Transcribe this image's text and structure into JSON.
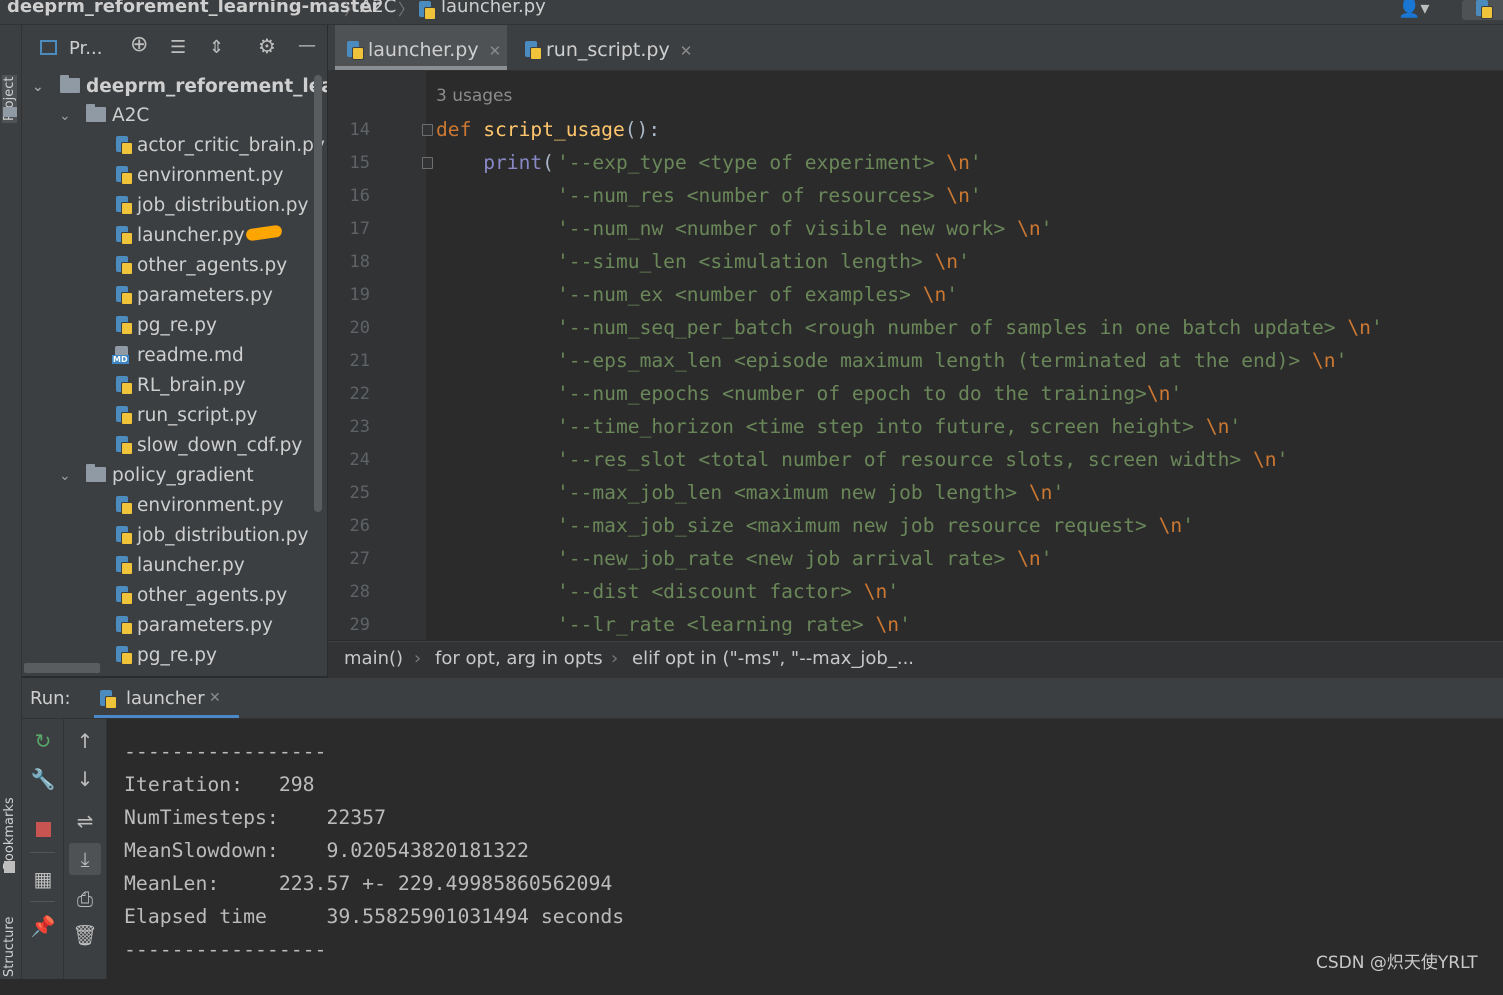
{
  "navbar": {
    "project": "deeprm_reforement_learning-master",
    "folder": "A2C",
    "file": "launcher.py"
  },
  "left_stripe": {
    "project_tab": "Project",
    "bookmarks_tab": "Bookmarks",
    "structure_tab": "Structure"
  },
  "project_panel": {
    "title": "Pr...",
    "root": "deeprm_reforement_learni",
    "folders": [
      {
        "name": "A2C",
        "files": [
          "actor_critic_brain.py",
          "environment.py",
          "job_distribution.py",
          "launcher.py",
          "other_agents.py",
          "parameters.py",
          "pg_re.py",
          "readme.md",
          "RL_brain.py",
          "run_script.py",
          "slow_down_cdf.py"
        ]
      },
      {
        "name": "policy_gradient",
        "files": [
          "environment.py",
          "job_distribution.py",
          "launcher.py",
          "other_agents.py",
          "parameters.py",
          "pg_re.py"
        ]
      }
    ]
  },
  "editor_tabs": [
    "launcher.py",
    "run_script.py"
  ],
  "editor": {
    "usages": "3 usages",
    "line_numbers": [
      "14",
      "15",
      "16",
      "17",
      "18",
      "19",
      "20",
      "21",
      "22",
      "23",
      "24",
      "25",
      "26",
      "27",
      "28",
      "29"
    ],
    "def_keyword": "def",
    "func_name": "script_usage",
    "def_tail": "():",
    "print_fn": "print",
    "print_paren": "(",
    "strings": [
      {
        "text": "'--exp_type <type of experiment> ",
        "esc": "\\n",
        "end": "'"
      },
      {
        "text": "'--num_res <number of resources> ",
        "esc": "\\n",
        "end": "'"
      },
      {
        "text": "'--num_nw <number of visible new work> ",
        "esc": "\\n",
        "end": "'"
      },
      {
        "text": "'--simu_len <simulation length> ",
        "esc": "\\n",
        "end": "'"
      },
      {
        "text": "'--num_ex <number of examples> ",
        "esc": "\\n",
        "end": "'"
      },
      {
        "text": "'--num_seq_per_batch <rough number of samples in one batch update> ",
        "esc": "\\n",
        "end": "'"
      },
      {
        "text": "'--eps_max_len <episode maximum length (terminated at the end)> ",
        "esc": "\\n",
        "end": "'"
      },
      {
        "text": "'--num_epochs <number of epoch to do the training>",
        "esc": "\\n",
        "end": "'"
      },
      {
        "text": "'--time_horizon <time step into future, screen height> ",
        "esc": "\\n",
        "end": "'"
      },
      {
        "text": "'--res_slot <total number of resource slots, screen width> ",
        "esc": "\\n",
        "end": "'"
      },
      {
        "text": "'--max_job_len <maximum new job length> ",
        "esc": "\\n",
        "end": "'"
      },
      {
        "text": "'--max_job_size <maximum new job resource request> ",
        "esc": "\\n",
        "end": "'"
      },
      {
        "text": "'--new_job_rate <new job arrival rate> ",
        "esc": "\\n",
        "end": "'"
      },
      {
        "text": "'--dist <discount factor> ",
        "esc": "\\n",
        "end": "'"
      },
      {
        "text": "'--lr_rate <learning rate> ",
        "esc": "\\n",
        "end": "'"
      }
    ]
  },
  "breadcrumb": [
    "main()",
    "for opt, arg in opts",
    "elif opt in (\"-ms\", \"--max_job_..."
  ],
  "run": {
    "label": "Run:",
    "config": "launcher",
    "console_lines": [
      "-----------------",
      "Iteration:   298",
      "NumTimesteps:    22357",
      "MeanSlowdown:    9.020543820181322",
      "MeanLen:     223.57 +- 229.49985860562094",
      "Elapsed time     39.55825901031494 seconds",
      "-----------------"
    ]
  },
  "watermark": "CSDN @炽天使YRLT",
  "colors": {
    "keyword": "#cc7832",
    "function": "#ffc66d",
    "builtin": "#8888c6",
    "string": "#6a8759",
    "background": "#2b2b2b",
    "highlight_mark": "#ffa500"
  }
}
